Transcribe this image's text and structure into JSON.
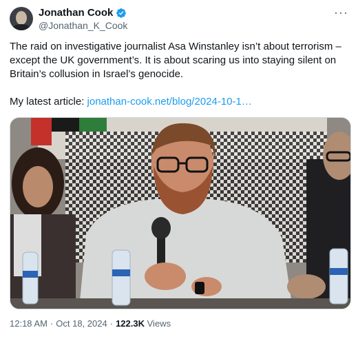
{
  "author": {
    "display_name": "Jonathan Cook",
    "handle": "@Jonathan_K_Cook",
    "verified": true
  },
  "more_icon": "more-horizontal-icon",
  "tweet": {
    "line1": "The raid on investigative journalist Asa Winstanley isn’t about terrorism –",
    "line2": "except the UK government’s. It is about scaring us into staying silent on",
    "line3": "Britain’s collusion in Israel’s genocide.",
    "article_prefix": "My latest article: ",
    "article_link": "jonathan-cook.net/blog/2024-10-1…"
  },
  "media": {
    "type": "photo"
  },
  "footer": {
    "time": "12:18 AM",
    "separator": "·",
    "date": "Oct 18, 2024",
    "views_count": "122.3K",
    "views_label": "Views"
  },
  "colors": {
    "link": "#1d9bf0",
    "secondary_text": "#536471",
    "verified_badge": "#1d9bf0"
  }
}
